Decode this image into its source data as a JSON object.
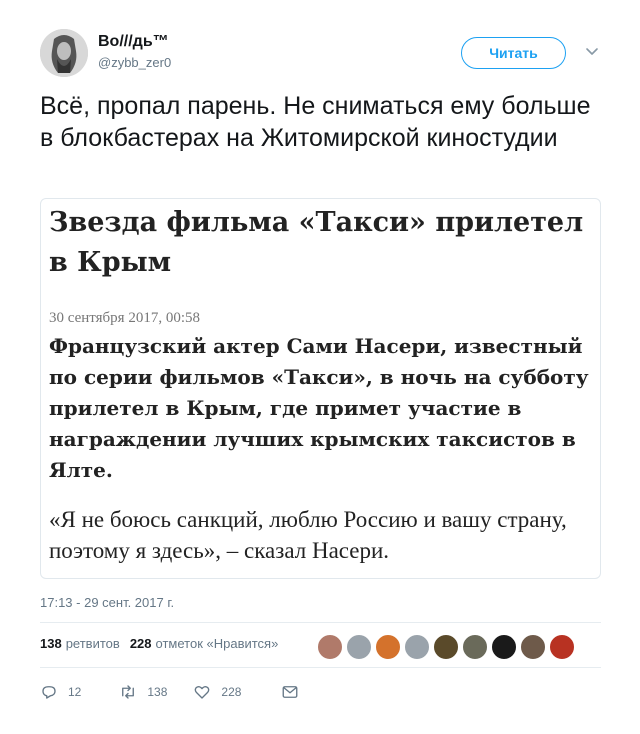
{
  "author": {
    "display_name": "Во///дь™",
    "handle": "@zybb_zer0",
    "avatar_icon": "avatar-portrait"
  },
  "follow_button": {
    "label": "Читать"
  },
  "menu": {
    "icon": "chevron-down-icon"
  },
  "tweet": {
    "text": "Всё, пропал парень. Не сниматься ему больше в блокбастерах на Житомирской киностудии"
  },
  "card": {
    "headline": "Звезда фильма «Такси» прилетел в Крым",
    "date": "30 сентября 2017, 00:58",
    "lead": "Французский актер Сами Насери, известный по серии фильмов «Такси», в ночь на субботу прилетел в Крым, где примет участие в награждении лучших крымских таксистов в Ялте.",
    "quote": "«Я не боюсь санкций, люблю Россию и вашу страну, поэтому я здесь», – сказал Насери."
  },
  "timestamp": "17:13 - 29 сент. 2017 г.",
  "stats": {
    "retweets_count": "138",
    "retweets_label": "ретвитов",
    "likes_count": "228",
    "likes_label": "отметок «Нравится»"
  },
  "likers_colors": [
    "#b07a6a",
    "#9aa3ab",
    "#d4722c",
    "#9aa3ab",
    "#5a4a2a",
    "#6a6a5a",
    "#1a1a1a",
    "#6e5a4a",
    "#b83222"
  ],
  "actions": {
    "reply_count": "12",
    "retweet_count": "138",
    "like_count": "228"
  },
  "colors": {
    "accent": "#1da1f2",
    "secondary_text": "#657786"
  }
}
